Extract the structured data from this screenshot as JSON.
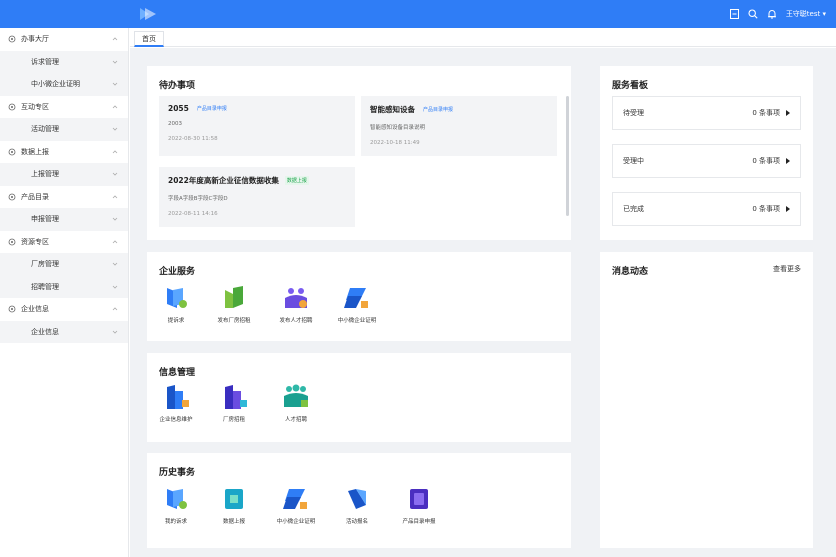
{
  "topbar": {
    "user_name": "王守聪test ▾",
    "icons": [
      "doc-icon",
      "search-icon",
      "bell-icon"
    ]
  },
  "sidebar": {
    "groups": [
      {
        "label": "办事大厅",
        "sub": [
          "诉求管理",
          "中小微企业证明"
        ]
      },
      {
        "label": "互动专区",
        "sub": [
          "活动管理"
        ]
      },
      {
        "label": "数据上报",
        "sub": [
          "上报管理"
        ]
      },
      {
        "label": "产品目录",
        "sub": [
          "申报管理"
        ]
      },
      {
        "label": "资源专区",
        "sub": [
          "厂房管理",
          "招聘管理"
        ]
      },
      {
        "label": "企业信息",
        "sub": [
          "企业信息"
        ]
      }
    ]
  },
  "tabs": {
    "home": "首页"
  },
  "todo": {
    "title": "待办事项",
    "items": [
      {
        "name": "2055",
        "tag": "产品目录申报",
        "desc": "2003",
        "time": "2022-08-30 11:58"
      },
      {
        "name": "智能感知设备",
        "tag": "产品目录申报",
        "desc": "智能感知设备目录说明",
        "time": "2022-10-18 11:49"
      },
      {
        "name": "2022年度高新企业征信数据收集",
        "tag": "数据上报",
        "desc": "字段A字段B字段C字段D",
        "time": "2022-08-11 14:16"
      }
    ]
  },
  "board": {
    "title": "服务看板",
    "rows": [
      {
        "label": "待受理",
        "count": "0 条事项"
      },
      {
        "label": "受理中",
        "count": "0 条事项"
      },
      {
        "label": "已完成",
        "count": "0 条事项"
      }
    ]
  },
  "enterprise": {
    "title": "企业服务",
    "apps": [
      "提诉求",
      "发布厂房招租",
      "发布人才招聘",
      "中小微企业证明"
    ]
  },
  "info": {
    "title": "信息管理",
    "apps": [
      "企业信息维护",
      "厂房招租",
      "人才招聘"
    ]
  },
  "history": {
    "title": "历史事务",
    "apps": [
      "我的诉求",
      "数据上报",
      "中小微企业证明",
      "活动报名",
      "产品目录申报"
    ]
  },
  "messages": {
    "title": "消息动态",
    "more": "查看更多"
  },
  "colors": {
    "primary": "#2f7df6",
    "page_bg": "#f0f2f5"
  }
}
